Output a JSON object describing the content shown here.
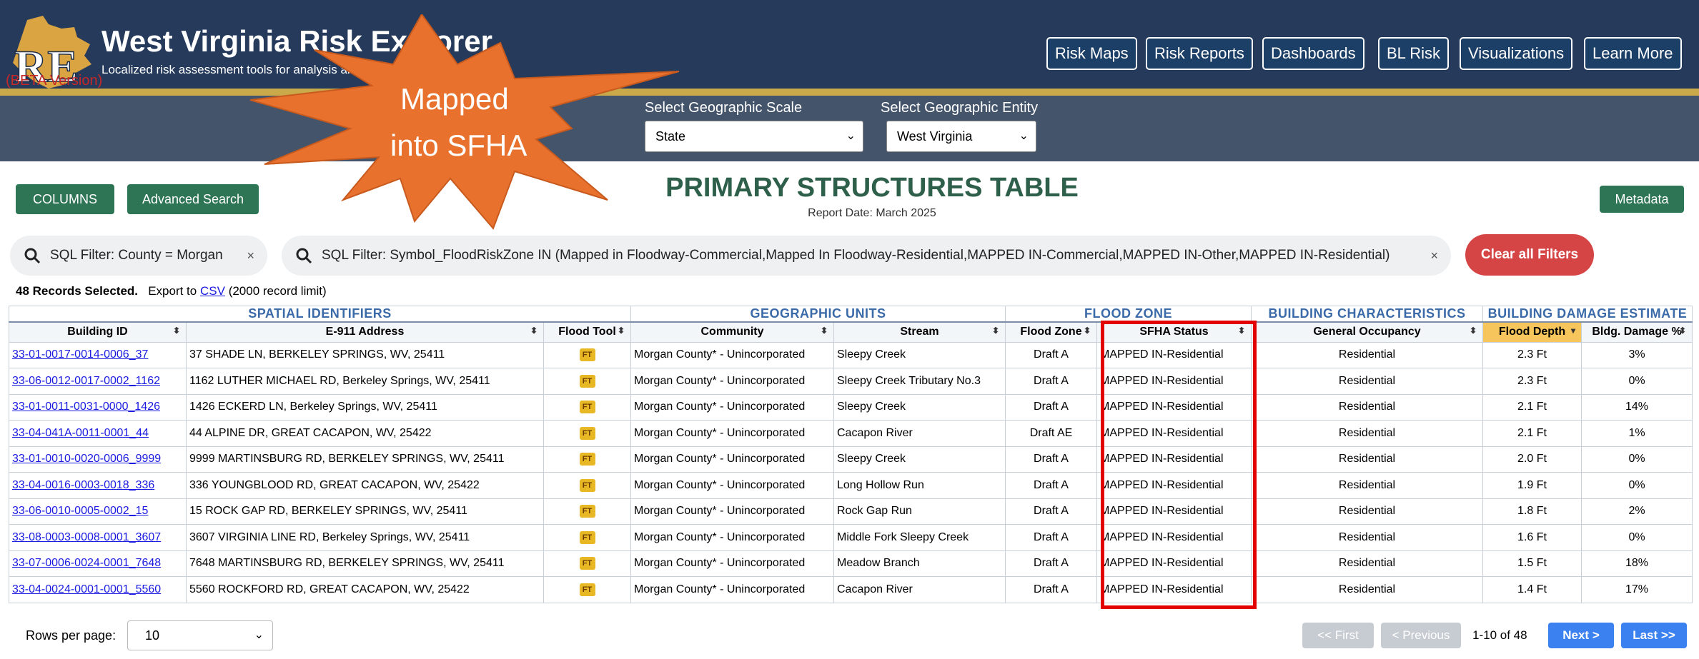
{
  "header": {
    "title": "West Virginia Risk Explorer",
    "subtitle": "Localized risk assessment tools for analysis and visualization",
    "beta": "(BETA Version)",
    "nav": [
      "Risk Maps",
      "Risk Reports",
      "Dashboards",
      "BL Risk",
      "Visualizations",
      "Learn More"
    ]
  },
  "selectors": {
    "scale_label": "Select Geographic Scale",
    "scale_value": "State",
    "entity_label": "Select Geographic Entity",
    "entity_value": "West Virginia"
  },
  "callout": {
    "line1": "Mapped",
    "line2": "into SFHA"
  },
  "toolbar": {
    "columns": "COLUMNS",
    "advanced": "Advanced Search",
    "title": "PRIMARY STRUCTURES TABLE",
    "report_date": "Report Date: March 2025",
    "metadata": "Metadata"
  },
  "filters": {
    "chip1": "SQL Filter: County = Morgan",
    "chip2": "SQL Filter: Symbol_FloodRiskZone IN (Mapped in Floodway-Commercial,Mapped In Floodway-Residential,MAPPED IN-Commercial,MAPPED IN-Other,MAPPED IN-Residential)",
    "clear": "Clear all Filters"
  },
  "records": {
    "selected": "48 Records Selected.",
    "export_prefix": "Export to",
    "csv": "CSV",
    "limit": "(2000 record limit)"
  },
  "groups": [
    "SPATIAL IDENTIFIERS",
    "GEOGRAPHIC UNITS",
    "FLOOD ZONE",
    "BUILDING CHARACTERISTICS",
    "BUILDING DAMAGE ESTIMATE"
  ],
  "columns": [
    "Building ID",
    "E-911 Address",
    "Flood Tool",
    "Community",
    "Stream",
    "Flood Zone",
    "SFHA Status",
    "General Occupancy",
    "Flood Depth",
    "Bldg. Damage %"
  ],
  "rows": [
    [
      "33-01-0017-0014-0006_37",
      "37 SHADE LN, BERKELEY SPRINGS, WV, 25411",
      "FT",
      "Morgan County* - Unincorporated",
      "Sleepy Creek",
      "Draft A",
      "MAPPED IN-Residential",
      "Residential",
      "2.3 Ft",
      "3%"
    ],
    [
      "33-06-0012-0017-0002_1162",
      "1162 LUTHER MICHAEL RD, Berkeley Springs, WV, 25411",
      "FT",
      "Morgan County* - Unincorporated",
      "Sleepy Creek Tributary No.3",
      "Draft A",
      "MAPPED IN-Residential",
      "Residential",
      "2.3 Ft",
      "0%"
    ],
    [
      "33-01-0011-0031-0000_1426",
      "1426 ECKERD LN, Berkeley Springs, WV, 25411",
      "FT",
      "Morgan County* - Unincorporated",
      "Sleepy Creek",
      "Draft A",
      "MAPPED IN-Residential",
      "Residential",
      "2.1 Ft",
      "14%"
    ],
    [
      "33-04-041A-0011-0001_44",
      "44 ALPINE DR, GREAT CACAPON, WV, 25422",
      "FT",
      "Morgan County* - Unincorporated",
      "Cacapon River",
      "Draft AE",
      "MAPPED IN-Residential",
      "Residential",
      "2.1 Ft",
      "1%"
    ],
    [
      "33-01-0010-0020-0006_9999",
      "9999 MARTINSBURG RD, BERKELEY SPRINGS, WV, 25411",
      "FT",
      "Morgan County* - Unincorporated",
      "Sleepy Creek",
      "Draft A",
      "MAPPED IN-Residential",
      "Residential",
      "2.0 Ft",
      "0%"
    ],
    [
      "33-04-0016-0003-0018_336",
      "336 YOUNGBLOOD RD, GREAT CACAPON, WV, 25422",
      "FT",
      "Morgan County* - Unincorporated",
      "Long Hollow Run",
      "Draft A",
      "MAPPED IN-Residential",
      "Residential",
      "1.9 Ft",
      "0%"
    ],
    [
      "33-06-0010-0005-0002_15",
      "15 ROCK GAP RD, BERKELEY SPRINGS, WV, 25411",
      "FT",
      "Morgan County* - Unincorporated",
      "Rock Gap Run",
      "Draft A",
      "MAPPED IN-Residential",
      "Residential",
      "1.8 Ft",
      "2%"
    ],
    [
      "33-08-0003-0008-0001_3607",
      "3607 VIRGINIA LINE RD, Berkeley Springs, WV, 25411",
      "FT",
      "Morgan County* - Unincorporated",
      "Middle Fork Sleepy Creek",
      "Draft A",
      "MAPPED IN-Residential",
      "Residential",
      "1.6 Ft",
      "0%"
    ],
    [
      "33-07-0006-0024-0001_7648",
      "7648 MARTINSBURG RD, BERKELEY SPRINGS, WV, 25411",
      "FT",
      "Morgan County* - Unincorporated",
      "Meadow Branch",
      "Draft A",
      "MAPPED IN-Residential",
      "Residential",
      "1.5 Ft",
      "18%"
    ],
    [
      "33-04-0024-0001-0001_5560",
      "5560 ROCKFORD RD, GREAT CACAPON, WV, 25422",
      "FT",
      "Morgan County* - Unincorporated",
      "Cacapon River",
      "Draft A",
      "MAPPED IN-Residential",
      "Residential",
      "1.4 Ft",
      "17%"
    ]
  ],
  "pagination": {
    "rows_label": "Rows per page:",
    "rows_value": "10",
    "first": "<< First",
    "prev": "< Previous",
    "range": "1-10 of 48",
    "next": "Next >",
    "last": "Last >>"
  },
  "colors": {
    "header_bg": "#263a5c",
    "accent_gold": "#c9a94a",
    "callout": "#e8712d",
    "highlight": "#e20000",
    "active_sort": "#f6c55c"
  }
}
